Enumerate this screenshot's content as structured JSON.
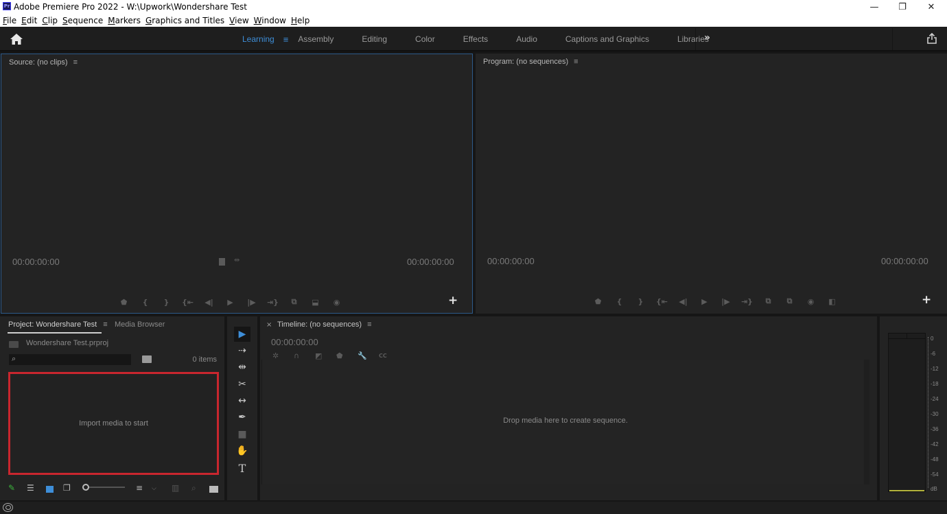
{
  "window": {
    "app_icon_label": "Pr",
    "title": "Adobe Premiere Pro 2022 - W:\\Upwork\\Wondershare Test",
    "minimize": "—",
    "maximize": "❐",
    "close": "✕"
  },
  "menubar": {
    "items": [
      {
        "accel": "F",
        "rest": "ile"
      },
      {
        "accel": "E",
        "rest": "dit"
      },
      {
        "accel": "C",
        "rest": "lip"
      },
      {
        "accel": "S",
        "rest": "equence"
      },
      {
        "accel": "M",
        "rest": "arkers"
      },
      {
        "accel": "G",
        "rest": "raphics and Titles"
      },
      {
        "accel": "V",
        "rest": "iew"
      },
      {
        "accel": "W",
        "rest": "indow"
      },
      {
        "accel": "H",
        "rest": "elp"
      }
    ]
  },
  "workspaces": {
    "home_icon": "home-icon",
    "active": "Learning",
    "menu_icon": "≡",
    "tabs": [
      "Assembly",
      "Editing",
      "Color",
      "Effects",
      "Audio",
      "Captions and Graphics",
      "Libraries"
    ],
    "more": "»",
    "share_icon": "share-icon"
  },
  "source": {
    "title": "Source: (no clips)",
    "menu": "≡",
    "tc_in": "00:00:00:00",
    "tc_out": "00:00:00:00",
    "controls": [
      "⬟",
      "{",
      "}",
      "{⇤",
      "◀|",
      "▶",
      "|▶",
      "⇥}",
      "⧉",
      "⬓",
      "◉"
    ],
    "add": "+"
  },
  "program": {
    "title": "Program: (no sequences)",
    "menu": "≡",
    "tc_in": "00:00:00:00",
    "tc_out": "00:00:00:00",
    "controls": [
      "⬟",
      "{",
      "}",
      "{⇤",
      "◀|",
      "▶",
      "|▶",
      "⇥}",
      "⧉",
      "⧉",
      "◉",
      "◧"
    ],
    "add": "+"
  },
  "project": {
    "tab_active": "Project: Wondershare Test",
    "menu": "≡",
    "tab_inactive": "Media Browser",
    "file": "Wondershare Test.prproj",
    "search_placeholder": "",
    "search_icon": "⌕",
    "items_count": "0 items",
    "empty_message": "Import media to start",
    "highlight_color": "#c9262e"
  },
  "tools": [
    "▶",
    "⇢",
    "⇹",
    "✂",
    "↔",
    "✒",
    "■",
    "✋",
    "T"
  ],
  "timeline": {
    "close": "×",
    "title": "Timeline: (no sequences)",
    "menu": "≡",
    "timecode": "00:00:00:00",
    "icons": [
      "✲",
      "∩",
      "◩",
      "⬟",
      "🔧",
      "CC"
    ],
    "drop_message": "Drop media here to create sequence."
  },
  "audio_meter": {
    "scale": [
      "0",
      "-6",
      "-12",
      "-18",
      "-24",
      "-30",
      "-36",
      "-42",
      "-48",
      "-54",
      "dB"
    ]
  }
}
